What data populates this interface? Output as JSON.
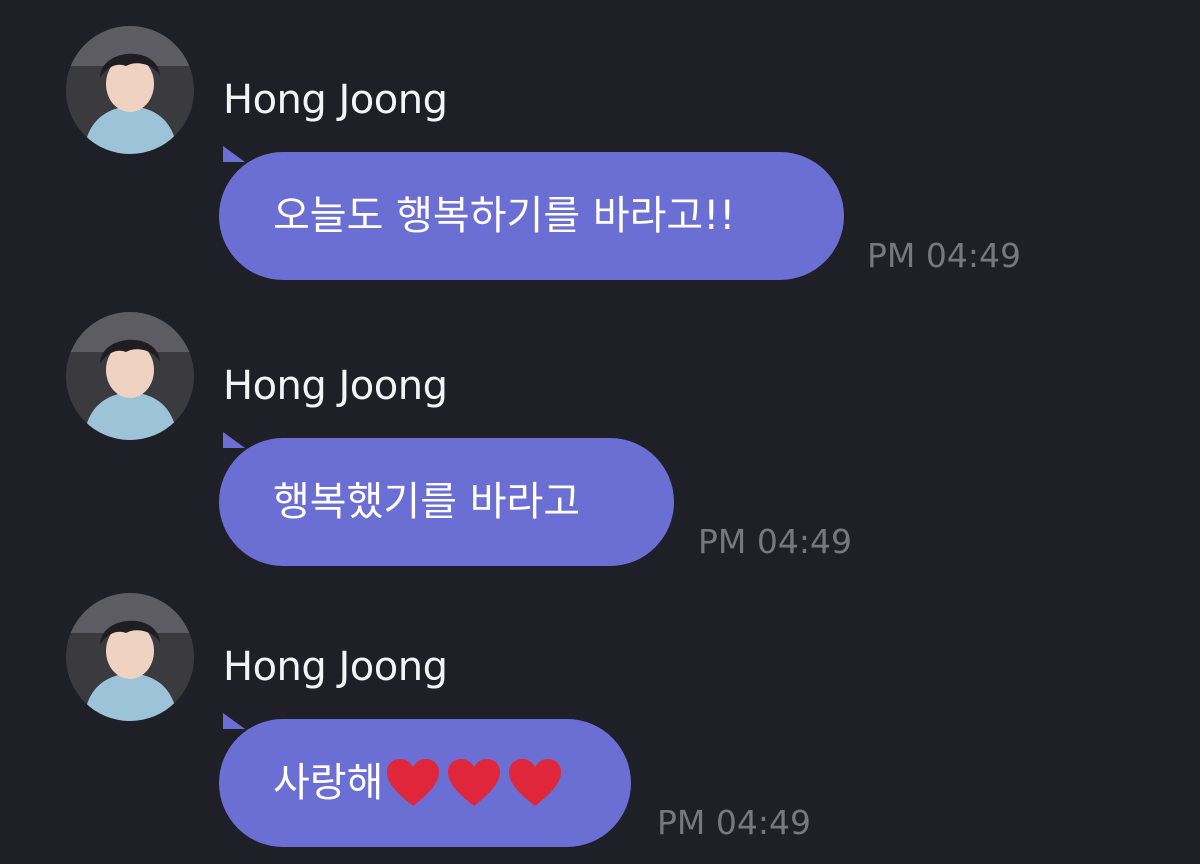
{
  "messages": [
    {
      "sender": "Hong Joong",
      "avatar": "profile-photo",
      "text": "오늘도 행복하기를 바라고!!",
      "time": "PM 04:49"
    },
    {
      "sender": "Hong Joong",
      "avatar": "profile-photo",
      "text": "행복했기를 바라고",
      "time": "PM 04:49"
    },
    {
      "sender": "Hong Joong",
      "avatar": "profile-photo",
      "text": "사랑해",
      "emoji": [
        "red-heart",
        "red-heart",
        "red-heart"
      ],
      "time": "PM 04:49"
    }
  ],
  "colors": {
    "background": "#1f1f27",
    "bubble": "#6b6fd4",
    "sender_text": "#f4f4f6",
    "bubble_text": "#ffffff",
    "timestamp": "#77777f",
    "heart": "#e0263a"
  }
}
